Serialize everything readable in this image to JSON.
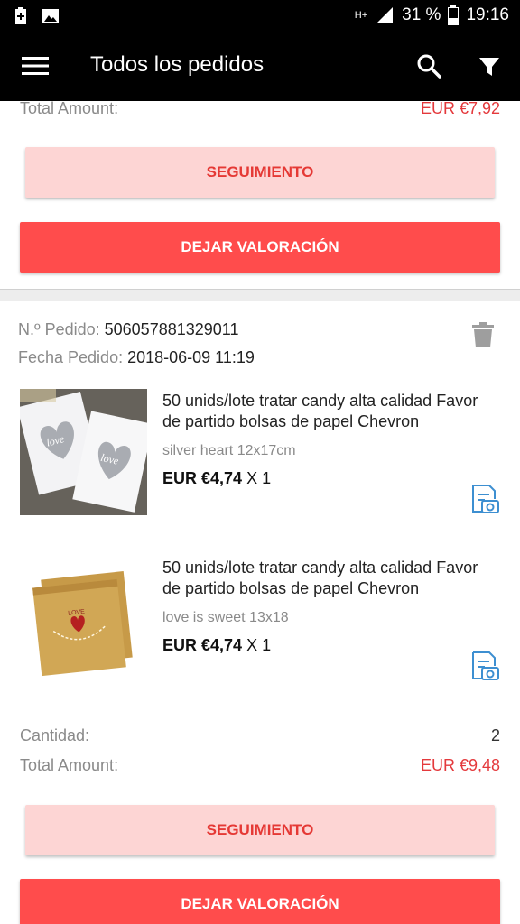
{
  "status_bar": {
    "battery_percent": "31 %",
    "time": "19:16",
    "network": "H+"
  },
  "app_bar": {
    "title": "Todos los pedidos"
  },
  "prev_order": {
    "total_label": "Total Amount:",
    "total_value": "EUR €7,92",
    "track_label": "SEGUIMIENTO",
    "rate_label": "DEJAR VALORACIÓN"
  },
  "order": {
    "number_label": "N.º Pedido:",
    "number_value": "506057881329011",
    "date_label": "Fecha Pedido:",
    "date_value": "2018-06-09 11:19",
    "products": [
      {
        "name": "50 unids/lote tratar candy alta calidad Favor de partido bolsas de papel Chevron",
        "variant": "silver heart 12x17cm",
        "price": "EUR €4,74",
        "qty": " X 1",
        "image_text": "love"
      },
      {
        "name": "50 unids/lote tratar candy alta calidad Favor de partido bolsas de papel Chevron",
        "variant": "love is sweet 13x18",
        "price": "EUR €4,74",
        "qty": " X 1",
        "image_text": "LOVE"
      }
    ],
    "qty_label": "Cantidad:",
    "qty_value": "2",
    "total_label": "Total Amount:",
    "total_value": "EUR €9,48",
    "track_label": "SEGUIMIENTO",
    "rate_label": "DEJAR VALORACIÓN"
  },
  "colors": {
    "accent": "#ff4c4c",
    "price_red": "#e4393c",
    "track_bg": "#fdd5d4",
    "review_icon": "#3d8fd1"
  }
}
